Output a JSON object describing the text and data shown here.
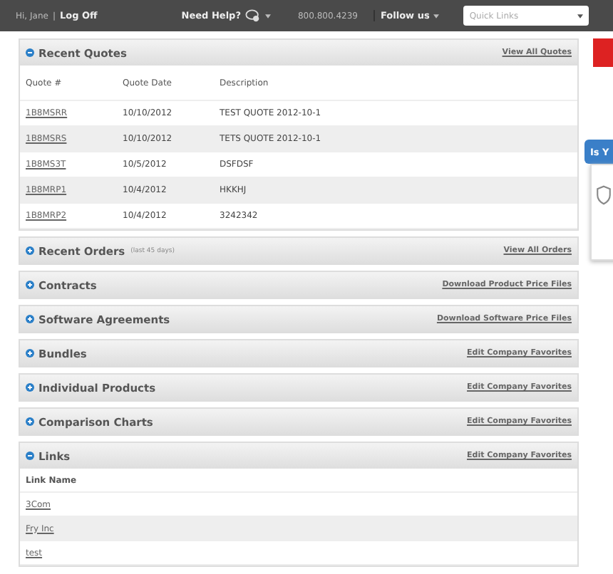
{
  "top_bar": {
    "greeting": "Hi, Jane",
    "separator": "|",
    "logoff": "Log Off",
    "help": "Need Help?",
    "phone": "800.800.4239",
    "follow": "Follow us",
    "quick_links": {
      "placeholder": "Quick Links"
    }
  },
  "side_tab": {
    "label": "Is Y"
  },
  "sections": [
    {
      "title": "Recent Quotes",
      "expanded": true,
      "link": "View All Quotes",
      "table": {
        "columns": [
          "Quote #",
          "Quote Date",
          "Description"
        ],
        "rows": [
          [
            "1B8MSRR",
            "10/10/2012",
            "TEST QUOTE 2012-10-1"
          ],
          [
            "1B8MSRS",
            "10/10/2012",
            "TETS QUOTE 2012-10-1"
          ],
          [
            "1B8MS3T",
            "10/5/2012",
            "DSFDSF"
          ],
          [
            "1B8MRP1",
            "10/4/2012",
            "HKKHJ"
          ],
          [
            "1B8MRP2",
            "10/4/2012",
            "3242342"
          ]
        ]
      }
    },
    {
      "title": "Recent Orders",
      "note": "(last 45 days)",
      "expanded": false,
      "link": "View All Orders"
    },
    {
      "title": "Contracts",
      "expanded": false,
      "link": "Download Product Price Files"
    },
    {
      "title": "Software Agreements",
      "expanded": false,
      "link": "Download Software Price Files"
    },
    {
      "title": "Bundles",
      "expanded": false,
      "link": "Edit Company Favorites"
    },
    {
      "title": "Individual Products",
      "expanded": false,
      "link": "Edit Company Favorites"
    },
    {
      "title": "Comparison Charts",
      "expanded": false,
      "link": "Edit Company Favorites"
    },
    {
      "title": "Links",
      "expanded": true,
      "link": "Edit Company Favorites",
      "table": {
        "columns": [
          "Link Name"
        ],
        "rows": [
          [
            "3Com"
          ],
          [
            "Fry Inc"
          ],
          [
            "test"
          ]
        ]
      }
    }
  ]
}
